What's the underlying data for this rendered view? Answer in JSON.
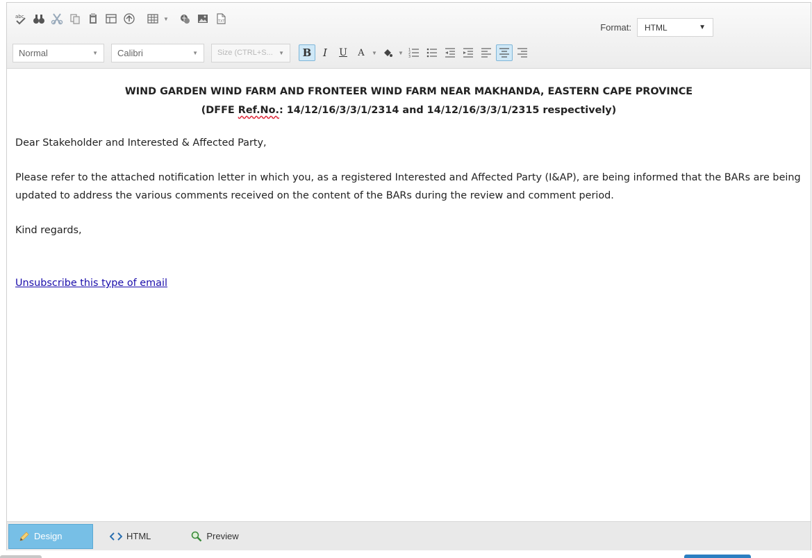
{
  "toolbar": {
    "format_label": "Format:",
    "format_value": "HTML",
    "paragraph_style": "Normal",
    "font_name": "Calibri",
    "font_size_placeholder": "Size (CTRL+S..."
  },
  "content": {
    "heading_line1": "WIND GARDEN WIND FARM AND FRONTEER WIND FARM NEAR MAKHANDA, EASTERN CAPE PROVINCE",
    "heading_line2_prefix": "(DFFE ",
    "heading_line2_ref": "Ref.No.",
    "heading_line2_suffix": ":  14/12/16/3/3/1/2314 and 14/12/16/3/3/1/2315 respectively)",
    "greeting": "Dear Stakeholder and Interested & Affected Party,",
    "body": "Please refer to the attached notification letter in which you, as a registered Interested and Affected Party (I&AP), are being informed that the BARs are being updated to address the various comments received on the content of the BARs during the review and comment period.",
    "closing": "Kind regards,",
    "unsubscribe": "Unsubscribe this type of email"
  },
  "modes": {
    "design": "Design",
    "html": "HTML",
    "preview": "Preview"
  },
  "colors": {
    "active_mode_bg": "#77bfe6",
    "link": "#1a0dab",
    "active_button_bg": "#cfe8f7"
  }
}
